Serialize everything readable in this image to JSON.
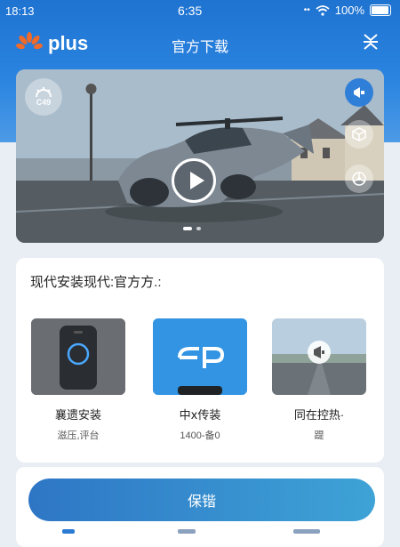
{
  "status_bar": {
    "time_left": "18:13",
    "time_center": "6:35",
    "battery": "100%"
  },
  "app_bar": {
    "logo_text": "plus",
    "title": "官方下载"
  },
  "hero": {
    "badge_text": "C49",
    "slide_count": 2,
    "active_slide": 1
  },
  "section": {
    "title": "现代安装现代:官方方.:",
    "tiles": [
      {
        "name": "襄遗安装",
        "sub": "滋压,评台"
      },
      {
        "name": "中ⅹ传装",
        "sub": "1400-备0"
      },
      {
        "name": "同在控热·",
        "sub": "踶"
      }
    ]
  },
  "primary_button": {
    "label": "保锴"
  },
  "colors": {
    "brand_blue": "#1f73d1",
    "button_start": "#2e76c5",
    "button_end": "#3ea3d6",
    "logo_orange": "#f06a2a"
  }
}
